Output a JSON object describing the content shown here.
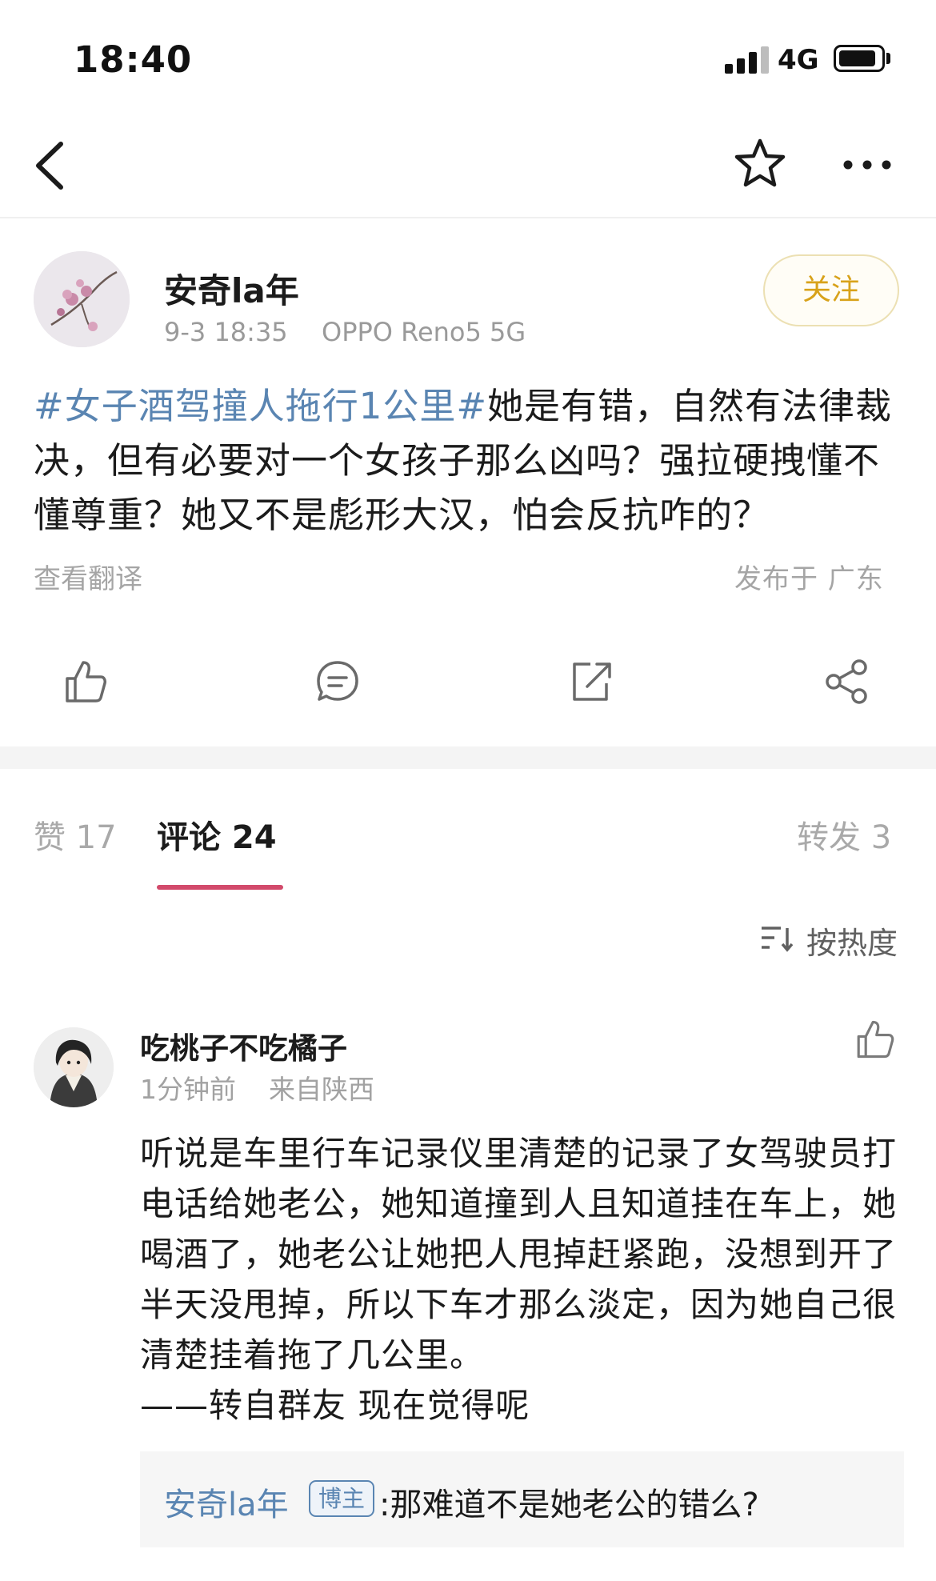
{
  "status_bar": {
    "time": "18:40",
    "network": "4G"
  },
  "nav": {
    "back_icon": "chevron-left-icon",
    "favorite_icon": "star-icon",
    "more_icon": "more-dots-icon"
  },
  "post": {
    "author": "安奇la年",
    "time": "9-3 18:35",
    "device": "OPPO Reno5 5G",
    "follow_label": "关注",
    "topic": "#女子酒驾撞人拖行1公里#",
    "body": "她是有错，自然有法律裁决，但有必要对一个女孩子那么凶吗？强拉硬拽懂不懂尊重？她又不是彪形大汉，怕会反抗咋的？",
    "translate_label": "查看翻译",
    "location": "发布于 广东"
  },
  "actions": [
    "thumb-up-icon",
    "comment-icon",
    "repost-icon",
    "share-icon"
  ],
  "tabs": {
    "likes": "赞 17",
    "comments": "评论 24",
    "reposts": "转发 3"
  },
  "sort": {
    "label": "按热度",
    "icon": "sort-icon"
  },
  "comment": {
    "user": "吃桃子不吃橘子",
    "time": "1分钟前",
    "location": "来自陕西",
    "text": "听说是车里行车记录仪里清楚的记录了女驾驶员打电话给她老公，她知道撞到人且知道挂在车上，她喝酒了，她老公让她把人甩掉赶紧跑，没想到开了半天没甩掉，所以下车才那么淡定，因为她自己很清楚挂着拖了几公里。\n——转自群友 现在觉得呢",
    "reply": {
      "user": "安奇la年",
      "badge": "博主",
      "text": ":那难道不是她老公的错么?"
    }
  },
  "colors": {
    "link": "#5a85b2",
    "follow": "#d8a21a",
    "tab_accent": "#d24a6b"
  }
}
